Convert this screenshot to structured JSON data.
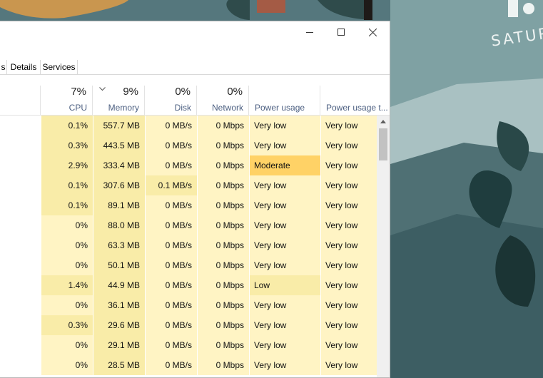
{
  "wallpaper": {
    "text": "SATUR"
  },
  "window": {
    "controls": [
      "minimize",
      "maximize",
      "close"
    ]
  },
  "tabs": [
    {
      "label": "s"
    },
    {
      "label": "Details"
    },
    {
      "label": "Services"
    }
  ],
  "columns": {
    "cpu": {
      "percent": "7%",
      "label": "CPU"
    },
    "memory": {
      "percent": "9%",
      "label": "Memory"
    },
    "disk": {
      "percent": "0%",
      "label": "Disk"
    },
    "network": {
      "percent": "0%",
      "label": "Network"
    },
    "power": {
      "label": "Power usage"
    },
    "power_trend": {
      "label": "Power usage t..."
    }
  },
  "colors": {
    "heat_light": "#fff4c4",
    "heat_mid": "#f9eca8",
    "heat_moderate": "#ffd266",
    "header_text": "#4d6082"
  },
  "rows": [
    {
      "cpu": "0.1%",
      "memory": "557.7 MB",
      "disk": "0 MB/s",
      "network": "0 Mbps",
      "power": "Very low",
      "power_trend": "Very low",
      "cpu_heat": "mid",
      "mem_heat": "mid",
      "disk_heat": "light",
      "power_heat": "light"
    },
    {
      "cpu": "0.3%",
      "memory": "443.5 MB",
      "disk": "0 MB/s",
      "network": "0 Mbps",
      "power": "Very low",
      "power_trend": "Very low",
      "cpu_heat": "mid",
      "mem_heat": "mid",
      "disk_heat": "light",
      "power_heat": "light"
    },
    {
      "cpu": "2.9%",
      "memory": "333.4 MB",
      "disk": "0 MB/s",
      "network": "0 Mbps",
      "power": "Moderate",
      "power_trend": "Very low",
      "cpu_heat": "mid",
      "mem_heat": "mid",
      "disk_heat": "light",
      "power_heat": "moderate"
    },
    {
      "cpu": "0.1%",
      "memory": "307.6 MB",
      "disk": "0.1 MB/s",
      "network": "0 Mbps",
      "power": "Very low",
      "power_trend": "Very low",
      "cpu_heat": "mid",
      "mem_heat": "mid",
      "disk_heat": "mid",
      "power_heat": "light"
    },
    {
      "cpu": "0.1%",
      "memory": "89.1 MB",
      "disk": "0 MB/s",
      "network": "0 Mbps",
      "power": "Very low",
      "power_trend": "Very low",
      "cpu_heat": "mid",
      "mem_heat": "mid",
      "disk_heat": "light",
      "power_heat": "light"
    },
    {
      "cpu": "0%",
      "memory": "88.0 MB",
      "disk": "0 MB/s",
      "network": "0 Mbps",
      "power": "Very low",
      "power_trend": "Very low",
      "cpu_heat": "light",
      "mem_heat": "mid",
      "disk_heat": "light",
      "power_heat": "light"
    },
    {
      "cpu": "0%",
      "memory": "63.3 MB",
      "disk": "0 MB/s",
      "network": "0 Mbps",
      "power": "Very low",
      "power_trend": "Very low",
      "cpu_heat": "light",
      "mem_heat": "mid",
      "disk_heat": "light",
      "power_heat": "light"
    },
    {
      "cpu": "0%",
      "memory": "50.1 MB",
      "disk": "0 MB/s",
      "network": "0 Mbps",
      "power": "Very low",
      "power_trend": "Very low",
      "cpu_heat": "light",
      "mem_heat": "mid",
      "disk_heat": "light",
      "power_heat": "light"
    },
    {
      "cpu": "1.4%",
      "memory": "44.9 MB",
      "disk": "0 MB/s",
      "network": "0 Mbps",
      "power": "Low",
      "power_trend": "Very low",
      "cpu_heat": "mid",
      "mem_heat": "mid",
      "disk_heat": "light",
      "power_heat": "mid"
    },
    {
      "cpu": "0%",
      "memory": "36.1 MB",
      "disk": "0 MB/s",
      "network": "0 Mbps",
      "power": "Very low",
      "power_trend": "Very low",
      "cpu_heat": "light",
      "mem_heat": "mid",
      "disk_heat": "light",
      "power_heat": "light"
    },
    {
      "cpu": "0.3%",
      "memory": "29.6 MB",
      "disk": "0 MB/s",
      "network": "0 Mbps",
      "power": "Very low",
      "power_trend": "Very low",
      "cpu_heat": "mid",
      "mem_heat": "mid",
      "disk_heat": "light",
      "power_heat": "light"
    },
    {
      "cpu": "0%",
      "memory": "29.1 MB",
      "disk": "0 MB/s",
      "network": "0 Mbps",
      "power": "Very low",
      "power_trend": "Very low",
      "cpu_heat": "light",
      "mem_heat": "mid",
      "disk_heat": "light",
      "power_heat": "light"
    },
    {
      "cpu": "0%",
      "memory": "28.5 MB",
      "disk": "0 MB/s",
      "network": "0 Mbps",
      "power": "Very low",
      "power_trend": "Very low",
      "cpu_heat": "light",
      "mem_heat": "mid",
      "disk_heat": "light",
      "power_heat": "light"
    }
  ]
}
